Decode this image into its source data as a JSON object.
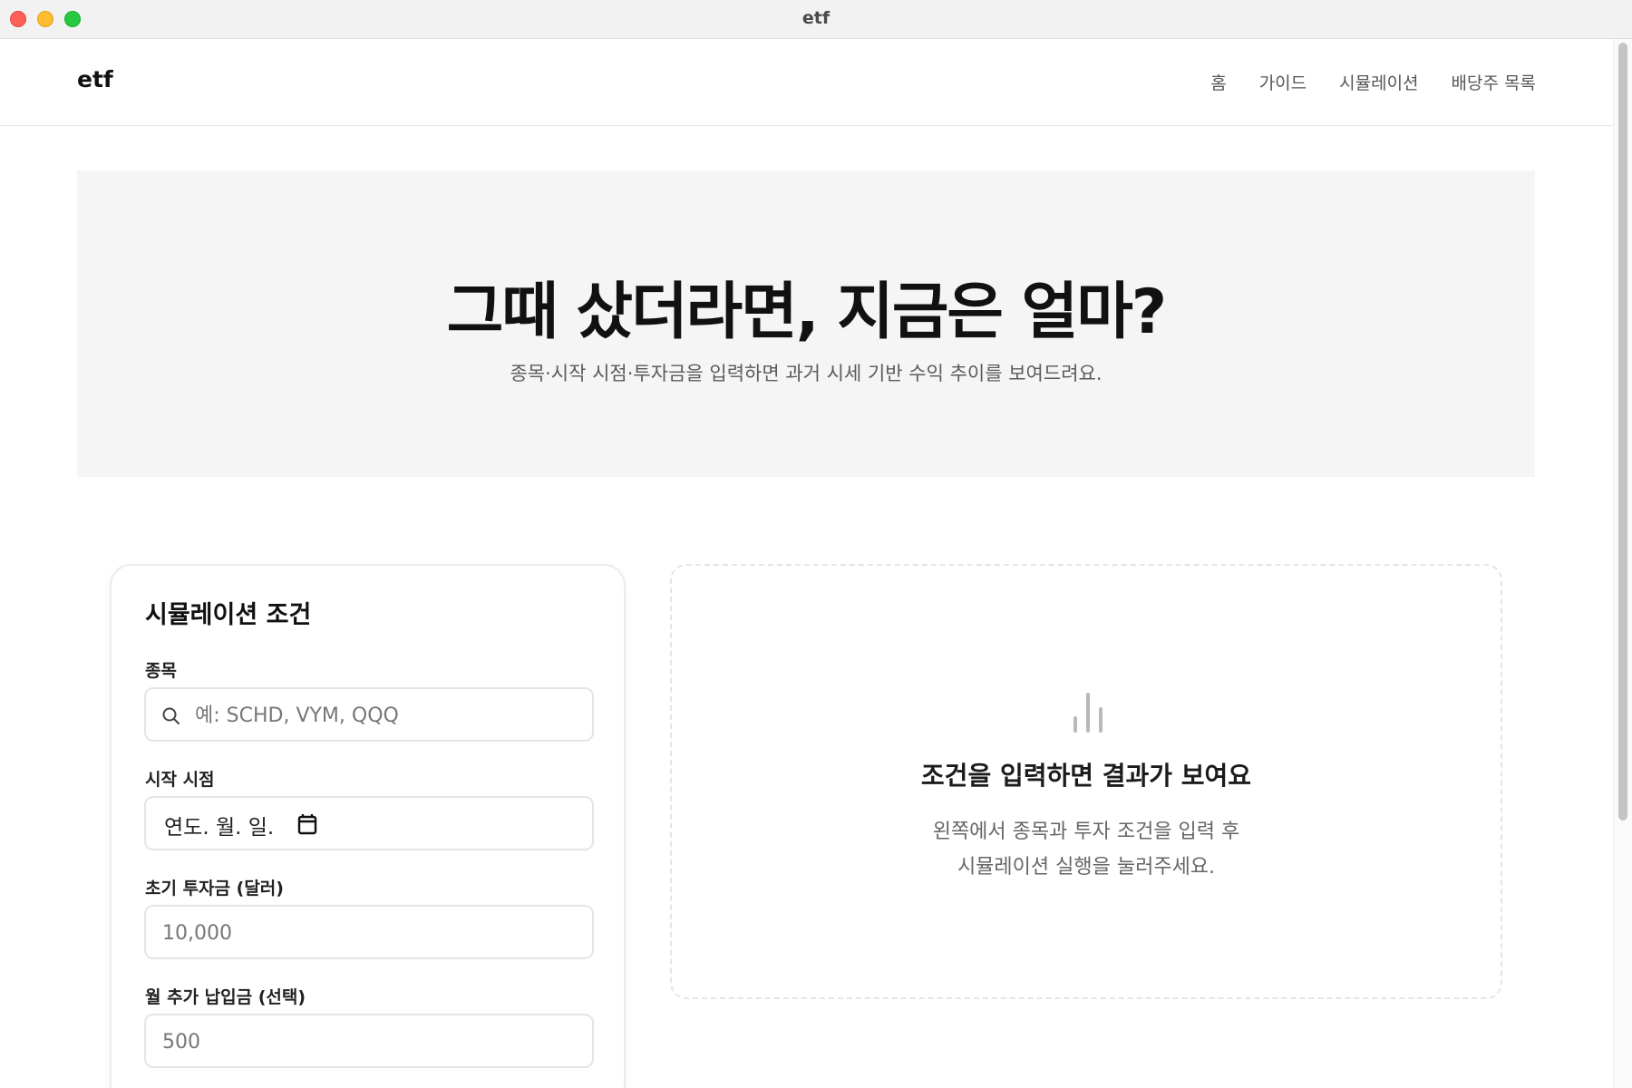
{
  "window": {
    "title": "etf"
  },
  "header": {
    "logo": "etf",
    "nav": [
      {
        "label": "홈"
      },
      {
        "label": "가이드"
      },
      {
        "label": "시뮬레이션"
      },
      {
        "label": "배당주 목록"
      }
    ]
  },
  "hero": {
    "title": "그때 샀더라면, 지금은 얼마?",
    "subtitle": "종목·시작 시점·투자금을 입력하면 과거 시세 기반 수익 추이를 보여드려요."
  },
  "form": {
    "title": "시뮬레이션 조건",
    "ticker": {
      "label": "종목",
      "placeholder": "예: SCHD, VYM, QQQ",
      "icon": "search-icon"
    },
    "start_date": {
      "label": "시작 시점",
      "value": "연도. 월. 일.",
      "icon": "calendar-icon"
    },
    "initial_investment": {
      "label": "초기 투자금 (달러)",
      "placeholder": "10,000"
    },
    "monthly_contribution": {
      "label": "월 추가 납입금 (선택)",
      "placeholder": "500"
    }
  },
  "result": {
    "icon": "bar-chart-icon",
    "title": "조건을 입력하면 결과가 보여요",
    "desc_line1": "왼쪽에서 종목과 투자 조건을 입력 후",
    "desc_line2": "시뮬레이션 실행을 눌러주세요."
  },
  "colors": {
    "hero_bg": "#f5f5f6",
    "border": "#e5e5e5",
    "text": "#111111",
    "muted": "#666666"
  }
}
